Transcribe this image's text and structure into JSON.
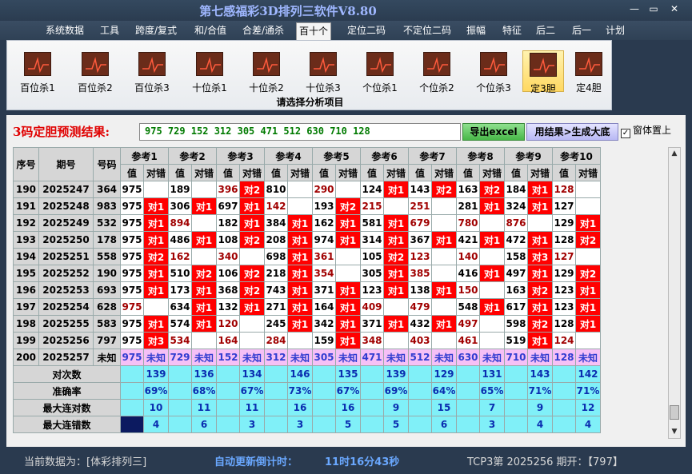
{
  "app": {
    "title": "第七感福彩3D排列三软件V8.80",
    "minimize": "—",
    "maximize": "▭",
    "close": "✕"
  },
  "menu": [
    "系统数据",
    "工具",
    "跨度/复式",
    "和/合值",
    "合差/通杀",
    "百十个",
    "定位二码",
    "不定位二码",
    "振幅",
    "特征",
    "后二",
    "后一",
    "计划"
  ],
  "menu_active_index": 5,
  "ribbon": {
    "items": [
      "百位杀1",
      "百位杀2",
      "百位杀3",
      "十位杀1",
      "十位杀2",
      "十位杀3",
      "个位杀1",
      "个位杀2",
      "个位杀3",
      "定3胆",
      "定4胆"
    ],
    "selected_index": 9,
    "caption": "请选择分析项目",
    "icon": "chart-icon"
  },
  "prediction": {
    "label": "3码定胆预测结果:",
    "value": "975  729  152  312  305  471  512  630  710  128",
    "export_button": "导出excel",
    "generate_button": "用结果>生成大底",
    "on_top_label": "窗体置上",
    "on_top_checked": true,
    "check_mark": "✓"
  },
  "table": {
    "col_seq": "序号",
    "col_issue": "期号",
    "col_number": "号码",
    "refs": [
      "参考1",
      "参考2",
      "参考3",
      "参考4",
      "参考5",
      "参考6",
      "参考7",
      "参考8",
      "参考9",
      "参考10"
    ],
    "sub_val": "值",
    "sub_mark": "对错",
    "rows": [
      {
        "seq": "190",
        "issue": "2025247",
        "num": "364",
        "cells": [
          [
            "975",
            ""
          ],
          [
            "189",
            ""
          ],
          [
            "396",
            "对2"
          ],
          [
            "810",
            ""
          ],
          [
            "290",
            ""
          ],
          [
            "124",
            "对1"
          ],
          [
            "143",
            "对2"
          ],
          [
            "163",
            "对2"
          ],
          [
            "184",
            "对1"
          ],
          [
            "128",
            ""
          ]
        ]
      },
      {
        "seq": "191",
        "issue": "2025248",
        "num": "983",
        "cells": [
          [
            "975",
            "对1"
          ],
          [
            "306",
            "对1"
          ],
          [
            "697",
            "对1"
          ],
          [
            "142",
            ""
          ],
          [
            "193",
            "对2"
          ],
          [
            "215",
            ""
          ],
          [
            "251",
            ""
          ],
          [
            "281",
            "对1"
          ],
          [
            "324",
            "对1"
          ],
          [
            "127",
            ""
          ]
        ]
      },
      {
        "seq": "192",
        "issue": "2025249",
        "num": "532",
        "cells": [
          [
            "975",
            "对1"
          ],
          [
            "894",
            ""
          ],
          [
            "182",
            "对1"
          ],
          [
            "384",
            "对1"
          ],
          [
            "162",
            "对1"
          ],
          [
            "581",
            "对1"
          ],
          [
            "679",
            ""
          ],
          [
            "780",
            ""
          ],
          [
            "876",
            ""
          ],
          [
            "129",
            "对1"
          ]
        ]
      },
      {
        "seq": "193",
        "issue": "2025250",
        "num": "178",
        "cells": [
          [
            "975",
            "对1"
          ],
          [
            "486",
            "对1"
          ],
          [
            "108",
            "对2"
          ],
          [
            "208",
            "对1"
          ],
          [
            "974",
            "对1"
          ],
          [
            "314",
            "对1"
          ],
          [
            "367",
            "对1"
          ],
          [
            "421",
            "对1"
          ],
          [
            "472",
            "对1"
          ],
          [
            "128",
            "对2"
          ]
        ]
      },
      {
        "seq": "194",
        "issue": "2025251",
        "num": "558",
        "cells": [
          [
            "975",
            "对2"
          ],
          [
            "162",
            ""
          ],
          [
            "340",
            ""
          ],
          [
            "698",
            "对1"
          ],
          [
            "361",
            ""
          ],
          [
            "105",
            "对2"
          ],
          [
            "123",
            ""
          ],
          [
            "140",
            ""
          ],
          [
            "158",
            "对3"
          ],
          [
            "127",
            ""
          ]
        ]
      },
      {
        "seq": "195",
        "issue": "2025252",
        "num": "190",
        "cells": [
          [
            "975",
            "对1"
          ],
          [
            "510",
            "对2"
          ],
          [
            "106",
            "对2"
          ],
          [
            "218",
            "对1"
          ],
          [
            "354",
            ""
          ],
          [
            "305",
            "对1"
          ],
          [
            "385",
            ""
          ],
          [
            "416",
            "对1"
          ],
          [
            "497",
            "对1"
          ],
          [
            "129",
            "对2"
          ]
        ]
      },
      {
        "seq": "196",
        "issue": "2025253",
        "num": "693",
        "cells": [
          [
            "975",
            "对1"
          ],
          [
            "173",
            "对1"
          ],
          [
            "368",
            "对2"
          ],
          [
            "743",
            "对1"
          ],
          [
            "371",
            "对1"
          ],
          [
            "123",
            "对1"
          ],
          [
            "138",
            "对1"
          ],
          [
            "150",
            ""
          ],
          [
            "163",
            "对2"
          ],
          [
            "123",
            "对1"
          ]
        ]
      },
      {
        "seq": "197",
        "issue": "2025254",
        "num": "628",
        "cells": [
          [
            "975",
            ""
          ],
          [
            "634",
            "对1"
          ],
          [
            "132",
            "对1"
          ],
          [
            "271",
            "对1"
          ],
          [
            "164",
            "对1"
          ],
          [
            "409",
            ""
          ],
          [
            "479",
            ""
          ],
          [
            "548",
            "对1"
          ],
          [
            "617",
            "对1"
          ],
          [
            "123",
            "对1"
          ]
        ]
      },
      {
        "seq": "198",
        "issue": "2025255",
        "num": "583",
        "cells": [
          [
            "975",
            "对1"
          ],
          [
            "574",
            "对1"
          ],
          [
            "120",
            ""
          ],
          [
            "245",
            "对1"
          ],
          [
            "342",
            "对1"
          ],
          [
            "371",
            "对1"
          ],
          [
            "432",
            "对1"
          ],
          [
            "497",
            ""
          ],
          [
            "598",
            "对2"
          ],
          [
            "128",
            "对1"
          ]
        ]
      },
      {
        "seq": "199",
        "issue": "2025256",
        "num": "797",
        "cells": [
          [
            "975",
            "对3"
          ],
          [
            "534",
            ""
          ],
          [
            "164",
            ""
          ],
          [
            "284",
            ""
          ],
          [
            "159",
            "对1"
          ],
          [
            "348",
            ""
          ],
          [
            "403",
            ""
          ],
          [
            "461",
            ""
          ],
          [
            "519",
            "对1"
          ],
          [
            "124",
            ""
          ]
        ]
      }
    ],
    "red_values": [
      [
        0,
        0,
        1,
        0,
        1,
        0,
        0,
        0,
        0,
        1
      ],
      [
        0,
        0,
        0,
        1,
        0,
        1,
        1,
        0,
        0,
        0
      ],
      [
        0,
        1,
        0,
        0,
        0,
        0,
        1,
        1,
        1,
        0
      ],
      [
        0,
        0,
        0,
        0,
        0,
        0,
        0,
        0,
        0,
        0
      ],
      [
        0,
        1,
        1,
        0,
        1,
        0,
        1,
        1,
        0,
        1
      ],
      [
        0,
        0,
        0,
        0,
        1,
        0,
        1,
        0,
        0,
        0
      ],
      [
        0,
        0,
        0,
        0,
        0,
        0,
        0,
        1,
        0,
        0
      ],
      [
        1,
        0,
        0,
        0,
        0,
        1,
        1,
        0,
        0,
        0
      ],
      [
        0,
        0,
        1,
        0,
        0,
        0,
        0,
        1,
        0,
        0
      ],
      [
        0,
        1,
        1,
        1,
        0,
        1,
        1,
        1,
        0,
        1
      ]
    ],
    "forecast": {
      "seq": "200",
      "issue": "2025257",
      "num": "未知",
      "values": [
        "975",
        "729",
        "152",
        "312",
        "305",
        "471",
        "512",
        "630",
        "710",
        "128"
      ],
      "mark": "未知"
    },
    "stats": [
      {
        "label": "对次数",
        "values": [
          "",
          "139",
          "",
          "136",
          "",
          "134",
          "",
          "146",
          "",
          "135",
          "",
          "139",
          "",
          "129",
          "",
          "131",
          "",
          "143",
          "",
          "142"
        ]
      },
      {
        "label": "准确率",
        "values": [
          "",
          "69%",
          "",
          "68%",
          "",
          "67%",
          "",
          "73%",
          "",
          "67%",
          "",
          "69%",
          "",
          "64%",
          "",
          "65%",
          "",
          "71%",
          "",
          "71%"
        ]
      },
      {
        "label": "最大连对数",
        "values": [
          "",
          "10",
          "",
          "11",
          "",
          "11",
          "",
          "16",
          "",
          "16",
          "",
          "9",
          "",
          "15",
          "",
          "7",
          "",
          "9",
          "",
          "12"
        ]
      },
      {
        "label": "最大连错数",
        "values": [
          "",
          "4",
          "",
          "6",
          "",
          "3",
          "",
          "3",
          "",
          "5",
          "",
          "5",
          "",
          "6",
          "",
          "3",
          "",
          "4",
          "",
          "4"
        ]
      }
    ]
  },
  "status": {
    "current_data": "当前数据为：[体彩排列三]",
    "countdown_label": "自动更新倒计时：",
    "countdown_value": "11时16分43秒",
    "draw_info": "TCP3第  2025256  期开：【797】"
  },
  "colors": {
    "hit": "#ff0000",
    "forecast_row": "#f6c0f6",
    "stats_row": "#80f0f8",
    "title_text": "#9fb7ff",
    "countdown": "#6aa8ff"
  }
}
